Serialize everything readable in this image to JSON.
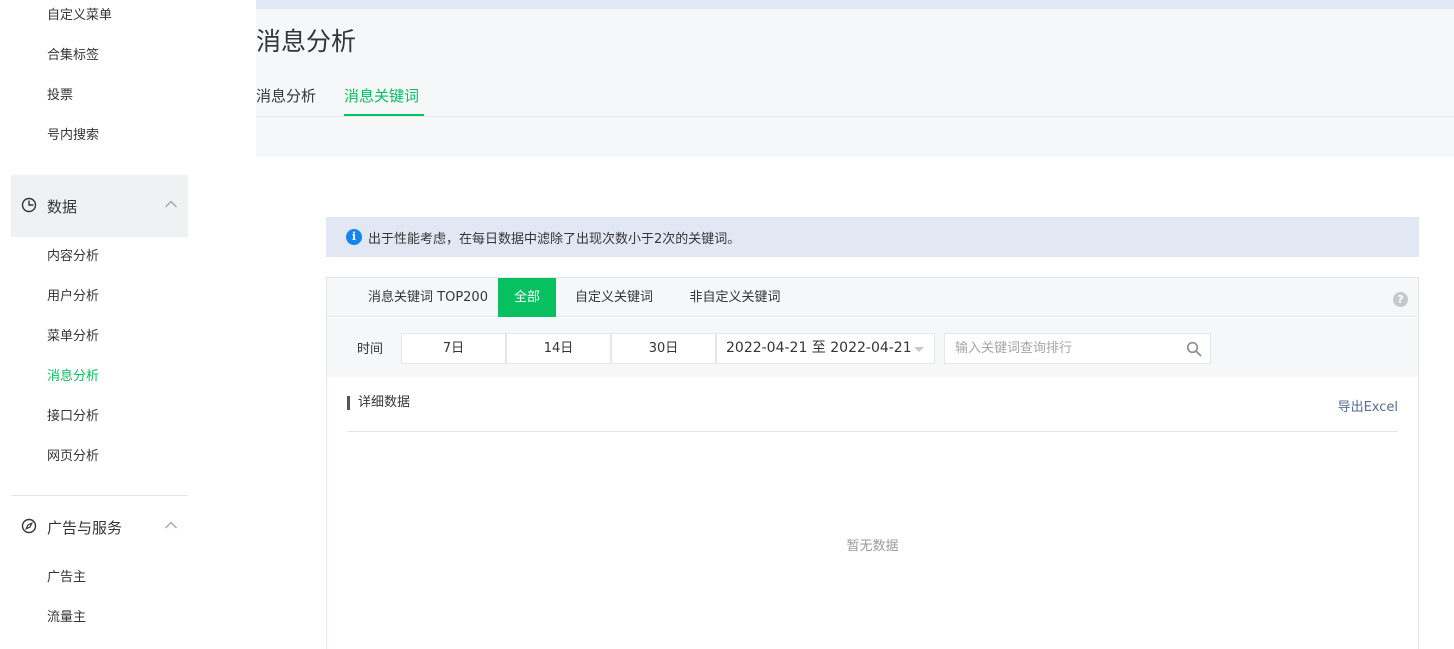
{
  "sidebar": {
    "items_top": [
      {
        "label": "自定义菜单"
      },
      {
        "label": "合集标签"
      },
      {
        "label": "投票"
      },
      {
        "label": "号内搜索"
      }
    ],
    "data_group": {
      "label": "数据",
      "icon": "pie-chart-icon",
      "expanded": true
    },
    "data_items": [
      {
        "label": "内容分析"
      },
      {
        "label": "用户分析"
      },
      {
        "label": "菜单分析"
      },
      {
        "label": "消息分析",
        "active": true
      },
      {
        "label": "接口分析"
      },
      {
        "label": "网页分析"
      }
    ],
    "ads_group": {
      "label": "广告与服务",
      "icon": "compass-icon",
      "expanded": true
    },
    "ads_items": [
      {
        "label": "广告主"
      },
      {
        "label": "流量主"
      }
    ]
  },
  "header": {
    "title": "消息分析",
    "tabs": [
      {
        "label": "消息分析"
      },
      {
        "label": "消息关键词",
        "active": true
      }
    ]
  },
  "notice": {
    "icon": "info-icon",
    "text": "出于性能考虑，在每日数据中滤除了出现次数小于2次的关键词。"
  },
  "panel": {
    "tabs": [
      {
        "label": "消息关键词 TOP200"
      },
      {
        "label": "全部",
        "active": true
      },
      {
        "label": "自定义关键词"
      },
      {
        "label": "非自定义关键词"
      }
    ],
    "help_icon": "?",
    "filter": {
      "time_label": "时间",
      "ranges": [
        "7日",
        "14日",
        "30日"
      ],
      "date_range": "2022-04-21 至 2022-04-21",
      "search_placeholder": "输入关键词查询排行"
    },
    "detail": {
      "title": "详细数据",
      "export_label": "导出Excel",
      "empty_text": "暂无数据"
    }
  },
  "colors": {
    "accent": "#07c160",
    "link": "#576b95",
    "notice_bg": "#e1e8f3",
    "info_icon": "#1485ee"
  }
}
